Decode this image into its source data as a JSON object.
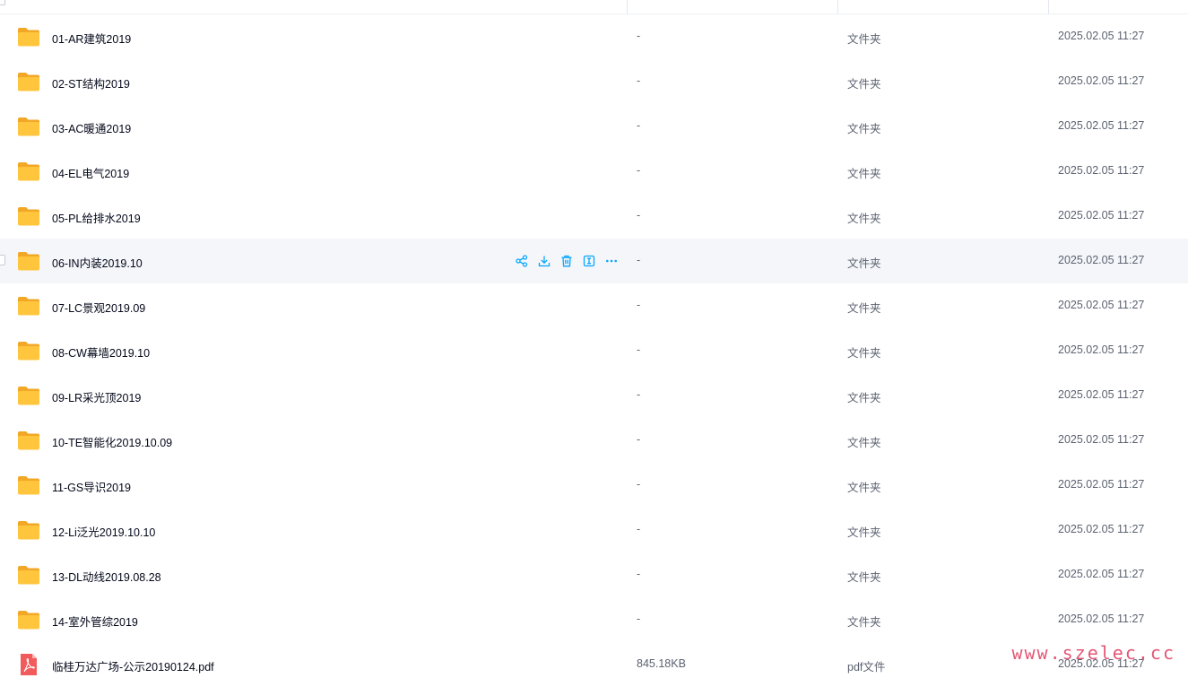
{
  "files": [
    {
      "name": "01-AR建筑2019",
      "size": "-",
      "type": "文件夹",
      "date": "2025.02.05 11:27",
      "icon": "folder-icon"
    },
    {
      "name": "02-ST结构2019",
      "size": "-",
      "type": "文件夹",
      "date": "2025.02.05 11:27",
      "icon": "folder-icon"
    },
    {
      "name": "03-AC暖通2019",
      "size": "-",
      "type": "文件夹",
      "date": "2025.02.05 11:27",
      "icon": "folder-icon"
    },
    {
      "name": "04-EL电气2019",
      "size": "-",
      "type": "文件夹",
      "date": "2025.02.05 11:27",
      "icon": "folder-icon"
    },
    {
      "name": "05-PL给排水2019",
      "size": "-",
      "type": "文件夹",
      "date": "2025.02.05 11:27",
      "icon": "folder-icon"
    },
    {
      "name": "06-IN内装2019.10",
      "size": "-",
      "type": "文件夹",
      "date": "2025.02.05 11:27",
      "icon": "folder-icon"
    },
    {
      "name": "07-LC景观2019.09",
      "size": "-",
      "type": "文件夹",
      "date": "2025.02.05 11:27",
      "icon": "folder-icon"
    },
    {
      "name": "08-CW幕墙2019.10",
      "size": "-",
      "type": "文件夹",
      "date": "2025.02.05 11:27",
      "icon": "folder-icon"
    },
    {
      "name": "09-LR采光顶2019",
      "size": "-",
      "type": "文件夹",
      "date": "2025.02.05 11:27",
      "icon": "folder-icon"
    },
    {
      "name": "10-TE智能化2019.10.09",
      "size": "-",
      "type": "文件夹",
      "date": "2025.02.05 11:27",
      "icon": "folder-icon"
    },
    {
      "name": "11-GS导识2019",
      "size": "-",
      "type": "文件夹",
      "date": "2025.02.05 11:27",
      "icon": "folder-icon"
    },
    {
      "name": "12-Li泛光2019.10.10",
      "size": "-",
      "type": "文件夹",
      "date": "2025.02.05 11:27",
      "icon": "folder-icon"
    },
    {
      "name": "13-DL动线2019.08.28",
      "size": "-",
      "type": "文件夹",
      "date": "2025.02.05 11:27",
      "icon": "folder-icon"
    },
    {
      "name": "14-室外管综2019",
      "size": "-",
      "type": "文件夹",
      "date": "2025.02.05 11:27",
      "icon": "folder-icon"
    },
    {
      "name": "临桂万达广场-公示20190124.pdf",
      "size": "845.18KB",
      "type": "pdf文件",
      "date": "2025.02.05 11:27",
      "icon": "pdf-icon"
    }
  ],
  "hovered_row": 5,
  "row_actions": [
    "share-icon",
    "download-icon",
    "delete-icon",
    "rename-icon",
    "more-icon"
  ],
  "watermark": "www.szelec.cc",
  "colors": {
    "accent": "#06a7ff",
    "folder": "#ffc53d",
    "pdf": "#f25b5b",
    "row_hover": "#f5f6fa",
    "watermark": "#e03a5f"
  }
}
